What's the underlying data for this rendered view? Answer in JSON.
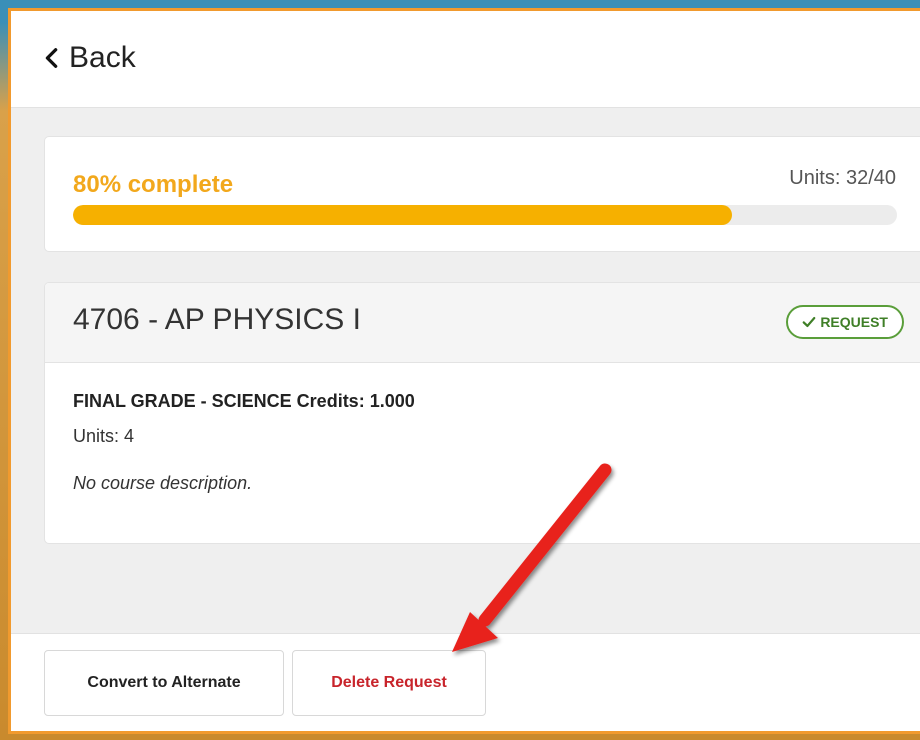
{
  "header": {
    "back_label": "Back"
  },
  "progress": {
    "label": "80% complete",
    "percent": 80,
    "units_label": "Units: 32/40"
  },
  "course": {
    "title": "4706 - AP PHYSICS I",
    "status_badge": "REQUEST",
    "credits_line": "FINAL GRADE - SCIENCE Credits: 1.000",
    "units_line": "Units: 4",
    "description": "No course description."
  },
  "footer": {
    "convert_label": "Convert to Alternate",
    "delete_label": "Delete Request"
  },
  "colors": {
    "accent": "#f6b000",
    "badge_green": "#5a9e3a",
    "delete_red": "#c8242b",
    "annotation_arrow": "#e8231f"
  },
  "icons": {
    "back": "chevron-left-icon",
    "badge": "check-icon"
  }
}
